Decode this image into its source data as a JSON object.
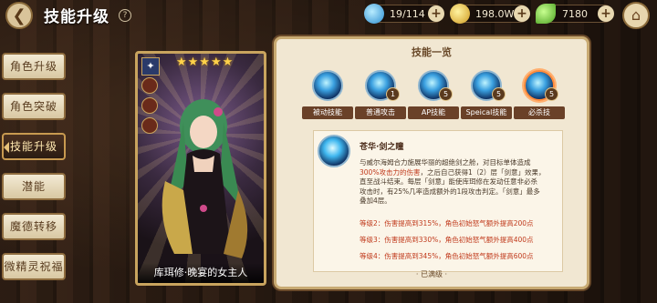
{
  "header": {
    "title": "技能升级",
    "help": "?",
    "resources": [
      {
        "name": "stamina",
        "value": "19/114",
        "icon": "blue-crystal-icon"
      },
      {
        "name": "gold",
        "value": "198.0W",
        "icon": "gold-coin-icon"
      },
      {
        "name": "leaf",
        "value": "7180",
        "icon": "green-leaf-icon"
      }
    ],
    "plus": "+"
  },
  "sidebar": {
    "items": [
      {
        "label": "角色升级"
      },
      {
        "label": "角色突破"
      },
      {
        "label": "技能升级"
      },
      {
        "label": "潜能"
      },
      {
        "label": "魔德转移"
      },
      {
        "label": "微精灵祝福"
      }
    ]
  },
  "card": {
    "stars": "★★★★★",
    "name": "库珥修·晚宴的女主人"
  },
  "panel": {
    "title": "技能一览",
    "skills": [
      {
        "label": "被动技能",
        "level": ""
      },
      {
        "label": "普通攻击",
        "level": "1"
      },
      {
        "label": "AP技能",
        "level": "5"
      },
      {
        "label": "Speical技能",
        "level": "5"
      },
      {
        "label": "必杀技",
        "level": "5"
      }
    ],
    "selected_skill": {
      "name": "苍华·剑之瞳",
      "desc_1": "与威尔海姆合力施展华丽的超绝剑之舱，对目标单体造成",
      "desc_2a": "300%攻击力的伤害",
      "desc_2b": "，之后自己获得1（2）层「剑意」效果，",
      "desc_3": "直至战斗结束。每层「剑意」能使库珥修在发动任意非必杀",
      "desc_4": "攻击时，有25%几率造成额外的1段攻击判定。「剑意」最多",
      "desc_5": "叠加4层。",
      "levels": [
        "等级2：伤害提高到315%，角色初始怒气额外提高200点",
        "等级3：伤害提高到330%，角色初始怒气额外提高400点",
        "等级4：伤害提高到345%，角色初始怒气额外提高600点"
      ],
      "maxed": "· 已满级 ·"
    }
  },
  "colors": {
    "accent": "#c0391b",
    "gold_border": "#c9a45e",
    "panel_bg": "#f1e7d2"
  }
}
